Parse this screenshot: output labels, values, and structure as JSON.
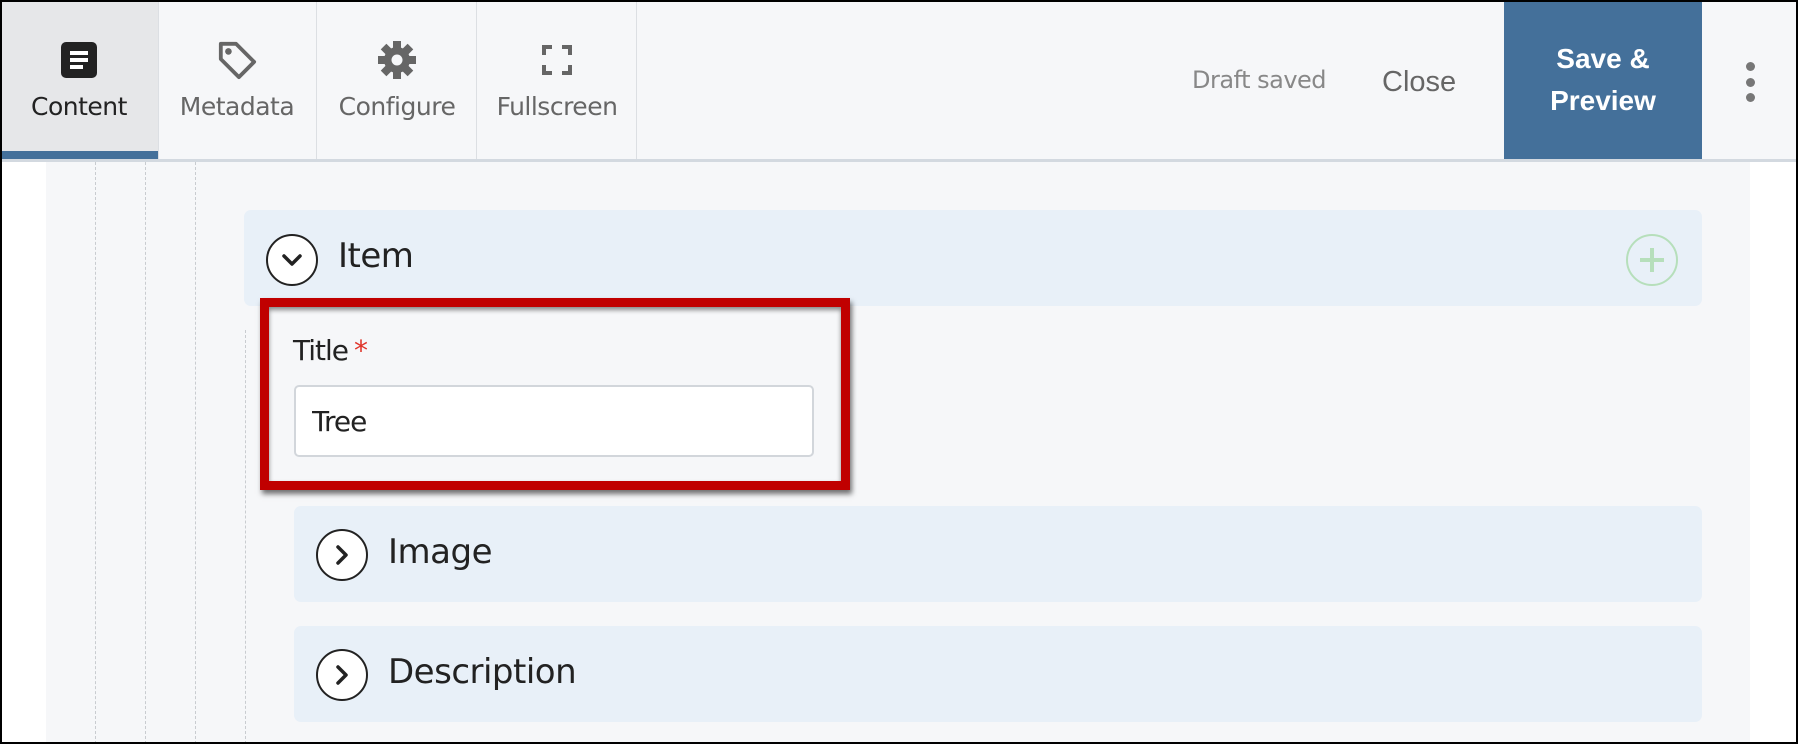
{
  "toolbar": {
    "tabs": [
      {
        "label": "Content",
        "icon": "document-icon",
        "active": true
      },
      {
        "label": "Metadata",
        "icon": "tag-icon",
        "active": false
      },
      {
        "label": "Configure",
        "icon": "gear-icon",
        "active": false
      },
      {
        "label": "Fullscreen",
        "icon": "fullscreen-icon",
        "active": false
      }
    ],
    "status": "Draft saved",
    "close_label": "Close",
    "save_label_line1": "Save &",
    "save_label_line2": "Preview",
    "more_icon": "vertical-ellipsis-icon"
  },
  "colors": {
    "accent": "#44709a",
    "highlight_box": "#c00000",
    "required": "#e0342a",
    "add_button": "#b6dfbb",
    "section_bg": "#e8f0f8"
  },
  "editor": {
    "item": {
      "title": "Item",
      "expanded": true,
      "field": {
        "label": "Title",
        "required_marker": "*",
        "value": "Tree"
      }
    },
    "subsections": [
      {
        "title": "Image",
        "expanded": false
      },
      {
        "title": "Description",
        "expanded": false
      }
    ]
  }
}
